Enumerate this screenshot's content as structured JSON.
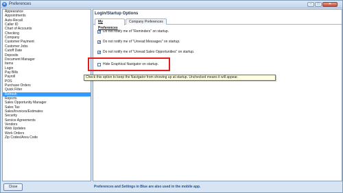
{
  "window": {
    "title": "Preferences",
    "icon": "app-icon",
    "controls": {
      "minimize": "–",
      "maximize": "□",
      "close": "✕"
    }
  },
  "sidebar": {
    "selected_index": 19,
    "items": [
      "Appearance",
      "Appointments",
      "Auto-Recall",
      "Caller ID",
      "Chart of Accounts",
      "Checking",
      "Company",
      "Customer Payment",
      "Customer Jobs",
      "Cutoff Date",
      "Deposits",
      "Document Manager",
      "Items",
      "Login",
      "Pay Bills",
      "Payroll",
      "POS",
      "Purchase Orders",
      "Quick Filter",
      "Refresh",
      "Reports",
      "Sales Opportunity Manager",
      "Sales Tax",
      "Sales/Invoices/Estimates",
      "Security",
      "Service Agreements",
      "Vendors",
      "Web Updates",
      "Work Orders",
      "Zip Codes/Area Code"
    ]
  },
  "panel": {
    "title": "Login/Startup Options",
    "tabs": [
      {
        "label": "My Preferences",
        "active": true
      },
      {
        "label": "Company Preferences",
        "active": false
      }
    ],
    "options": [
      {
        "label": "Do not notify me of \"Reminders\" on startup.",
        "checked": true
      },
      {
        "label": "Do not notify me of \"Unread Messages\" on startup.",
        "checked": true
      },
      {
        "label": "Do not notify me of \"Unread Sales Opportunities\" on startup.",
        "checked": true
      },
      {
        "label": "Hide Graphical Navigator on startup.",
        "checked": false
      }
    ]
  },
  "tooltip": {
    "text": "Check this option to keep the Navigator from showing up at startup.  Unchecked means it will appear."
  },
  "footer": {
    "close_label": "Close",
    "note": "Preferences and Settings in Blue are also used in the mobile app."
  },
  "colors": {
    "selection": "#3399ff",
    "highlight_border": "#e41b1b",
    "tooltip_bg": "#ffffe1",
    "note_text": "#1f4f96"
  }
}
